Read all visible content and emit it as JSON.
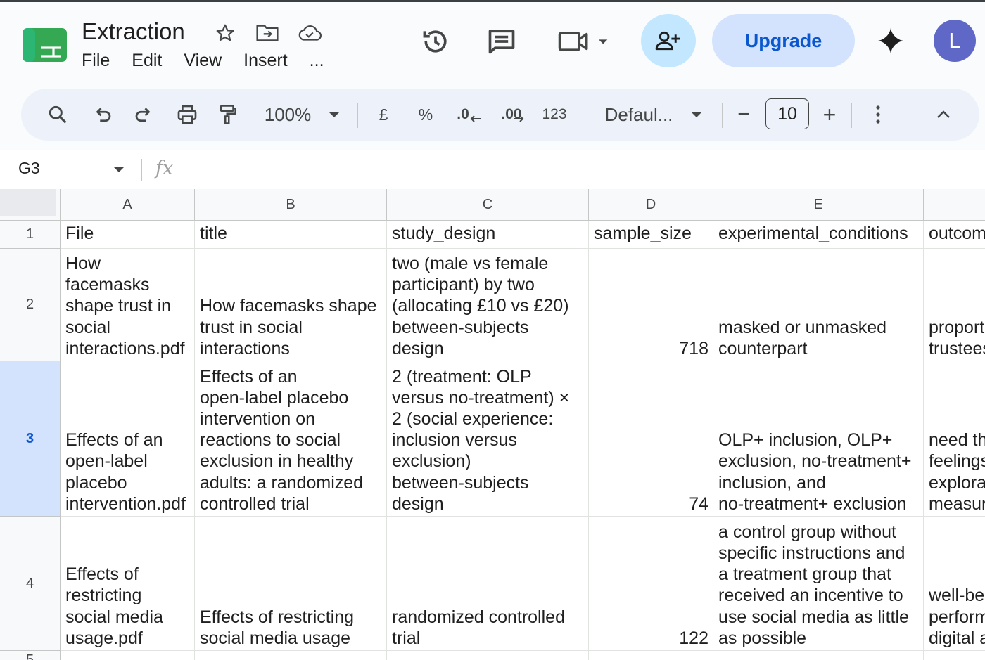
{
  "app": {
    "doc_title": "Extraction",
    "menu": [
      "File",
      "Edit",
      "View",
      "Insert",
      "..."
    ],
    "upgrade_label": "Upgrade",
    "avatar_letter": "L"
  },
  "toolbar": {
    "zoom": "100%",
    "currency": "£",
    "percent": "%",
    "dec_decrease": ".0",
    "dec_increase": ".00",
    "number_format": "123",
    "font": "Defaul...",
    "font_size_minus": "−",
    "font_size": "10",
    "font_size_plus": "+"
  },
  "formula_bar": {
    "cell_ref": "G3",
    "fx_label": "fx"
  },
  "sheet": {
    "columns": [
      "A",
      "B",
      "C",
      "D",
      "E"
    ],
    "rows": [
      "1",
      "2",
      "3",
      "4",
      "5"
    ],
    "selected_row": "3",
    "cells": [
      [
        "File",
        "title",
        "study_design",
        "sample_size",
        "experimental_conditions",
        "outcom"
      ],
      [
        "How\nfacemasks\nshape trust in\nsocial\ninteractions.pdf",
        "How facemasks shape\ntrust in social\ninteractions",
        "two (male vs female\nparticipant) by two\n(allocating £10 vs £20)\nbetween-subjects\ndesign",
        "718",
        "masked or unmasked\ncounterpart",
        "proport\ntrustees"
      ],
      [
        "Effects of an\nopen-label\nplacebo\nintervention.pdf",
        "Effects of an\nopen-label placebo\nintervention on\nreactions to social\nexclusion in healthy\nadults: a randomized\ncontrolled trial",
        "2 (treatment: OLP\nversus no-treatment) ×\n2 (social experience:\ninclusion versus\nexclusion)\nbetween-subjects\ndesign",
        "74",
        "OLP+ inclusion, OLP+\nexclusion, no-treatment+\ninclusion, and\nno-treatment+ exclusion",
        "need th\nfeelings\nexplora\nmeasur"
      ],
      [
        "Effects of\nrestricting\nsocial media\nusage.pdf",
        "Effects of restricting\nsocial media usage",
        "randomized controlled\ntrial",
        "122",
        "a control group without\nspecific instructions and\na treatment group that\nreceived an incentive to\nuse social media as little\nas possible",
        "well-be\nperform\ndigital a"
      ]
    ]
  }
}
